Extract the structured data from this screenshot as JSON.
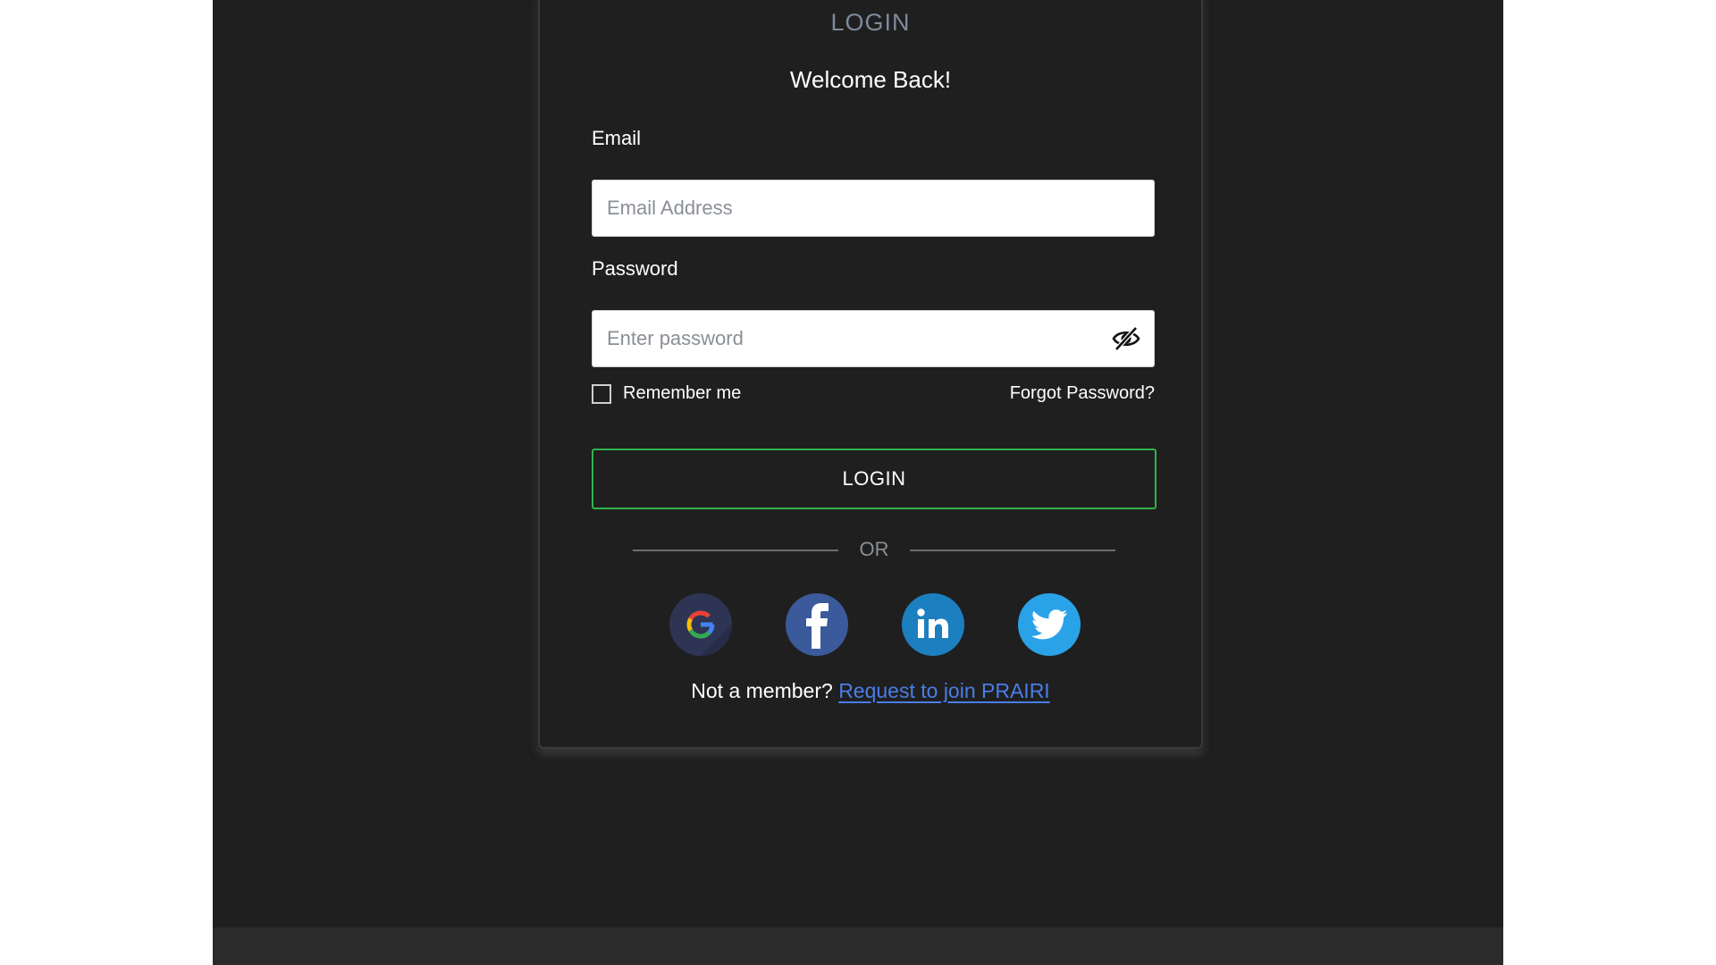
{
  "card": {
    "header": "LOGIN",
    "welcome": "Welcome Back!"
  },
  "email": {
    "label": "Email",
    "placeholder": "Email Address",
    "value": ""
  },
  "password": {
    "label": "Password",
    "placeholder": "Enter password",
    "value": "",
    "toggle_icon": "eye-slash-icon"
  },
  "remember": {
    "label": "Remember me",
    "checked": false
  },
  "forgot_password": "Forgot Password?",
  "login_button": "LOGIN",
  "divider_text": "OR",
  "social": [
    {
      "name": "google",
      "icon": "google-icon"
    },
    {
      "name": "facebook",
      "icon": "facebook-icon"
    },
    {
      "name": "linkedin",
      "icon": "linkedin-icon"
    },
    {
      "name": "twitter",
      "icon": "twitter-icon"
    }
  ],
  "signup": {
    "prompt": "Not a member?",
    "link": "Request to join PRAIRI"
  },
  "colors": {
    "background": "#1f1f1f",
    "login_button_border": "#2fb34a",
    "link": "#4a7de8",
    "header_text": "#7e8a9b"
  }
}
